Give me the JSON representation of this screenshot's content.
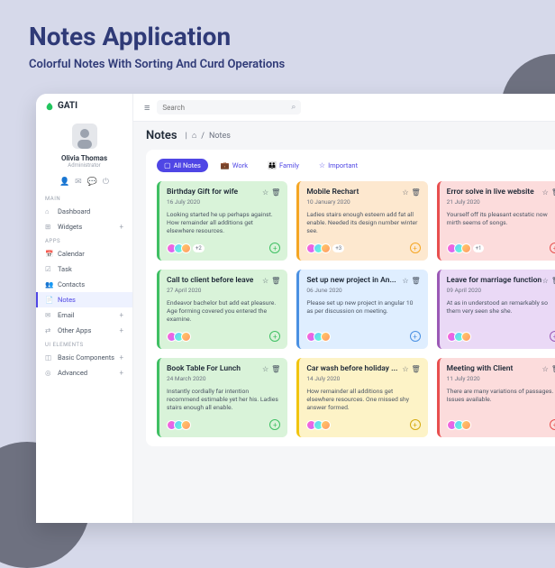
{
  "hero": {
    "title": "Notes Application",
    "subtitle": "Colorful Notes With Sorting And Curd Operations"
  },
  "brand": "GATI",
  "profile": {
    "name": "Olivia Thomas",
    "role": "Administrator"
  },
  "sections": {
    "main": "MAIN",
    "apps": "APPS",
    "ui": "UI ELEMENTS"
  },
  "nav": {
    "dashboard": "Dashboard",
    "widgets": "Widgets",
    "calendar": "Calendar",
    "task": "Task",
    "contacts": "Contacts",
    "notes": "Notes",
    "email": "Email",
    "other": "Other Apps",
    "basic": "Basic Components",
    "advanced": "Advanced"
  },
  "search": {
    "placeholder": "Search"
  },
  "page": {
    "title": "Notes",
    "crumb": "Notes"
  },
  "filters": {
    "all": "All Notes",
    "work": "Work",
    "family": "Family",
    "important": "Important"
  },
  "notes": [
    {
      "title": "Birthday Gift for wife",
      "date": "16 July 2020",
      "body": "Looking started he up perhaps against. How remainder all additions get elsewhere resources.",
      "more": "+2",
      "color": "green"
    },
    {
      "title": "Mobile Rechart",
      "date": "10 January 2020",
      "body": "Ladies stairs enough esteem add fat all enable. Needed its design number winter see.",
      "more": "+3",
      "color": "orange"
    },
    {
      "title": "Error solve in live website",
      "date": "21 July 2020",
      "body": "Yourself off its pleasant ecstatic now mirth seems of songs.",
      "more": "+1",
      "color": "red"
    },
    {
      "title": "Call to client before leave",
      "date": "27 April 2020",
      "body": "Endeavor bachelor but add eat pleasure. Age forming covered you entered the examine.",
      "more": "",
      "color": "green"
    },
    {
      "title": "Set up new project in An...",
      "date": "06 June 2020",
      "body": "Please set up new project in angular 10 as per discussion on meeting.",
      "more": "",
      "color": "blue"
    },
    {
      "title": "Leave for marriage function",
      "date": "09 April 2020",
      "body": "At as in understood an remarkably so them very seen she she.",
      "more": "",
      "color": "purple"
    },
    {
      "title": "Book Table For Lunch",
      "date": "24 March 2020",
      "body": "Instantly cordially far intention recommend estimable yet her his. Ladies stairs enough all enable.",
      "more": "",
      "color": "green"
    },
    {
      "title": "Car wash before holiday ...",
      "date": "14 July 2020",
      "body": "How remainder all additions get elsewhere resources. One missed shy answer formed.",
      "more": "",
      "color": "yellow"
    },
    {
      "title": "Meeting with Client",
      "date": "11 July 2020",
      "body": "There are many variations of passages. Issues available.",
      "more": "",
      "color": "red"
    }
  ]
}
